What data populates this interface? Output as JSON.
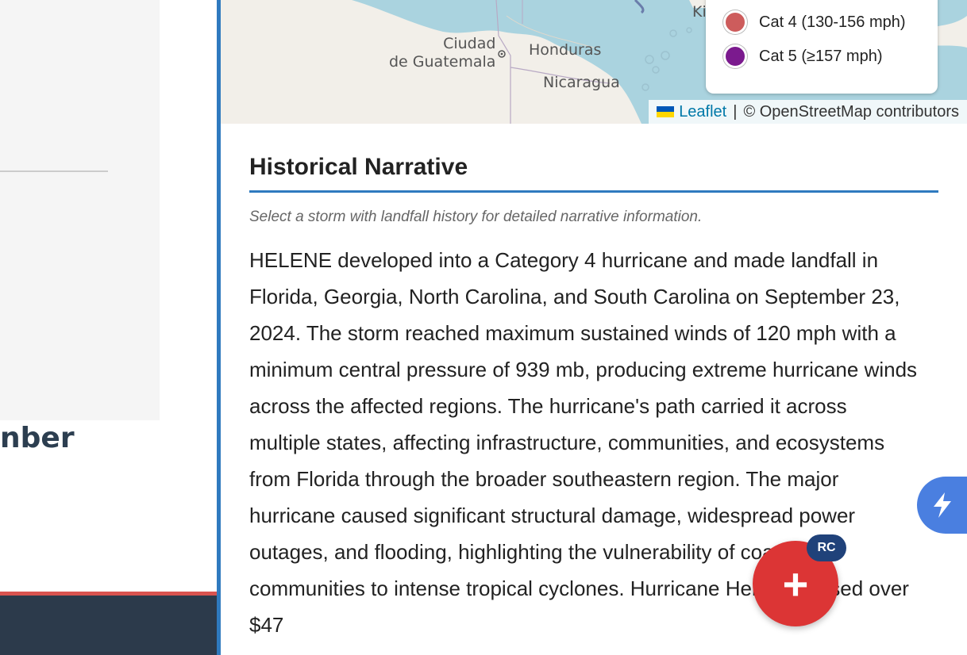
{
  "left_panel": {
    "heading_fragment": "nber"
  },
  "map": {
    "labels": {
      "city": "Ciudad\nde Guatemala",
      "country1": "Honduras",
      "country2": "Nicaragua",
      "partial": "Kin"
    },
    "legend": [
      {
        "label": "Cat 4 (130-156 mph)",
        "color": "#cd5c5c"
      },
      {
        "label": "Cat 5 (≥157 mph)",
        "color": "#7b1a8e"
      }
    ],
    "attribution": {
      "leaflet": "Leaflet",
      "separator": "|",
      "osm": "© OpenStreetMap contributors"
    }
  },
  "narrative": {
    "title": "Historical Narrative",
    "hint": "Select a storm with landfall history for detailed narrative information.",
    "body": "HELENE developed into a Category 4 hurricane and made landfall in Florida, Georgia, North Carolina, and South Carolina on September 23, 2024. The storm reached maximum sustained winds of 120 mph with a minimum central pressure of 939 mb, producing extreme hurricane winds across the affected regions. The hurricane's path carried it across multiple states, affecting infrastructure, communities, and ecosystems from Florida through the broader southeastern region. The major hurricane caused significant structural damage, widespread power outages, and flooding, highlighting the vulnerability of coastal communities to intense tropical cyclones. Hurricane Helene caused over $47"
  },
  "controls": {
    "fab_symbol": "+",
    "fab_badge": "RC",
    "quick_action_icon": "lightning-icon"
  }
}
